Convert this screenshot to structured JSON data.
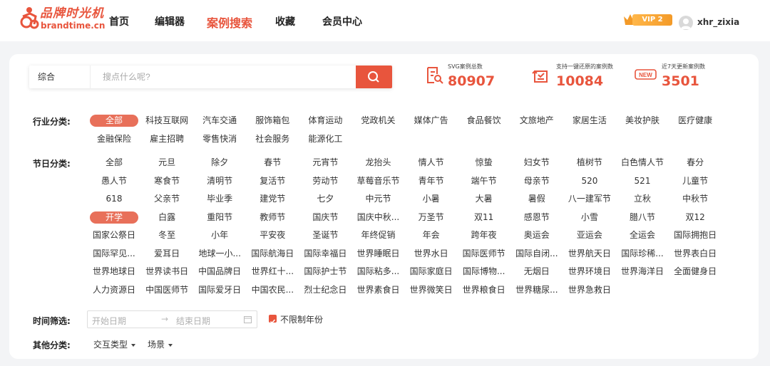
{
  "header": {
    "logo_text": "品牌时光机",
    "logo_domain": "brandtime.cn",
    "nav": [
      "首页",
      "编辑器",
      "案例搜索",
      "收藏",
      "会员中心"
    ],
    "active_nav": "案例搜索",
    "vip_label": "VIP 2",
    "username": "xhr_zixia"
  },
  "search": {
    "type": "综合",
    "placeholder": "搜点什么呢?",
    "button_icon": "search-icon"
  },
  "stats": [
    {
      "label": "SVG案例总数",
      "value": "80907",
      "icon": "document-search-icon"
    },
    {
      "label": "支持一键还原的案例数",
      "value": "10084",
      "icon": "restore-icon"
    },
    {
      "label": "近7天更新案例数",
      "value": "3501",
      "icon": "new-badge-icon"
    }
  ],
  "filters": {
    "industry_label": "行业分类:",
    "industry": [
      "全部",
      "科技互联网",
      "汽车交通",
      "服饰箱包",
      "体育运动",
      "党政机关",
      "媒体广告",
      "食品餐饮",
      "文旅地产",
      "家居生活",
      "美妆护肤",
      "医疗健康",
      "金融保险",
      "雇主招聘",
      "零售快消",
      "社会服务",
      "能源化工"
    ],
    "industry_selected": "全部",
    "holiday_label": "节日分类:",
    "holiday": [
      "全部",
      "元旦",
      "除夕",
      "春节",
      "元宵节",
      "龙抬头",
      "情人节",
      "惊蛰",
      "妇女节",
      "植树节",
      "白色情人节",
      "春分",
      "愚人节",
      "寒食节",
      "清明节",
      "复活节",
      "劳动节",
      "草莓音乐节",
      "青年节",
      "端午节",
      "母亲节",
      "520",
      "521",
      "儿童节",
      "618",
      "父亲节",
      "毕业季",
      "建党节",
      "七夕",
      "中元节",
      "小暑",
      "大暑",
      "暑假",
      "八一建军节",
      "立秋",
      "中秋节",
      "开学",
      "白露",
      "重阳节",
      "教师节",
      "国庆节",
      "国庆中秋...",
      "万圣节",
      "双11",
      "感恩节",
      "小雪",
      "腊八节",
      "双12",
      "国家公祭日",
      "冬至",
      "小年",
      "平安夜",
      "圣诞节",
      "年终促销",
      "年会",
      "跨年夜",
      "奥运会",
      "亚运会",
      "全运会",
      "国际拥抱日",
      "国际罕见...",
      "爱耳日",
      "地球一小...",
      "国际航海日",
      "国际幸福日",
      "世界睡眠日",
      "世界水日",
      "国际医师节",
      "国际自闭...",
      "世界航天日",
      "国际珍稀...",
      "世界表白日",
      "世界地球日",
      "世界读书日",
      "中国品牌日",
      "世界红十...",
      "国际护士节",
      "国际粘多...",
      "国际家庭日",
      "国际博物...",
      "无烟日",
      "世界环境日",
      "世界海洋日",
      "全面健身日",
      "人力资源日",
      "中国医师节",
      "国际爱牙日",
      "中国农民...",
      "烈士纪念日",
      "世界素食日",
      "世界微笑日",
      "世界粮食日",
      "世界糖尿...",
      "世界急救日"
    ],
    "holiday_selected": "开学",
    "time_label": "时间筛选:",
    "start_placeholder": "开始日期",
    "end_placeholder": "结束日期",
    "date_arrow": "→",
    "unlimited_year": "不限制年份",
    "unlimited_checked": true,
    "other_label": "其他分类:",
    "other": [
      "交互类型",
      "场景"
    ]
  },
  "colors": {
    "accent": "#e8553d",
    "selected_tag": "#e8705a",
    "vip": "#f39a28"
  }
}
